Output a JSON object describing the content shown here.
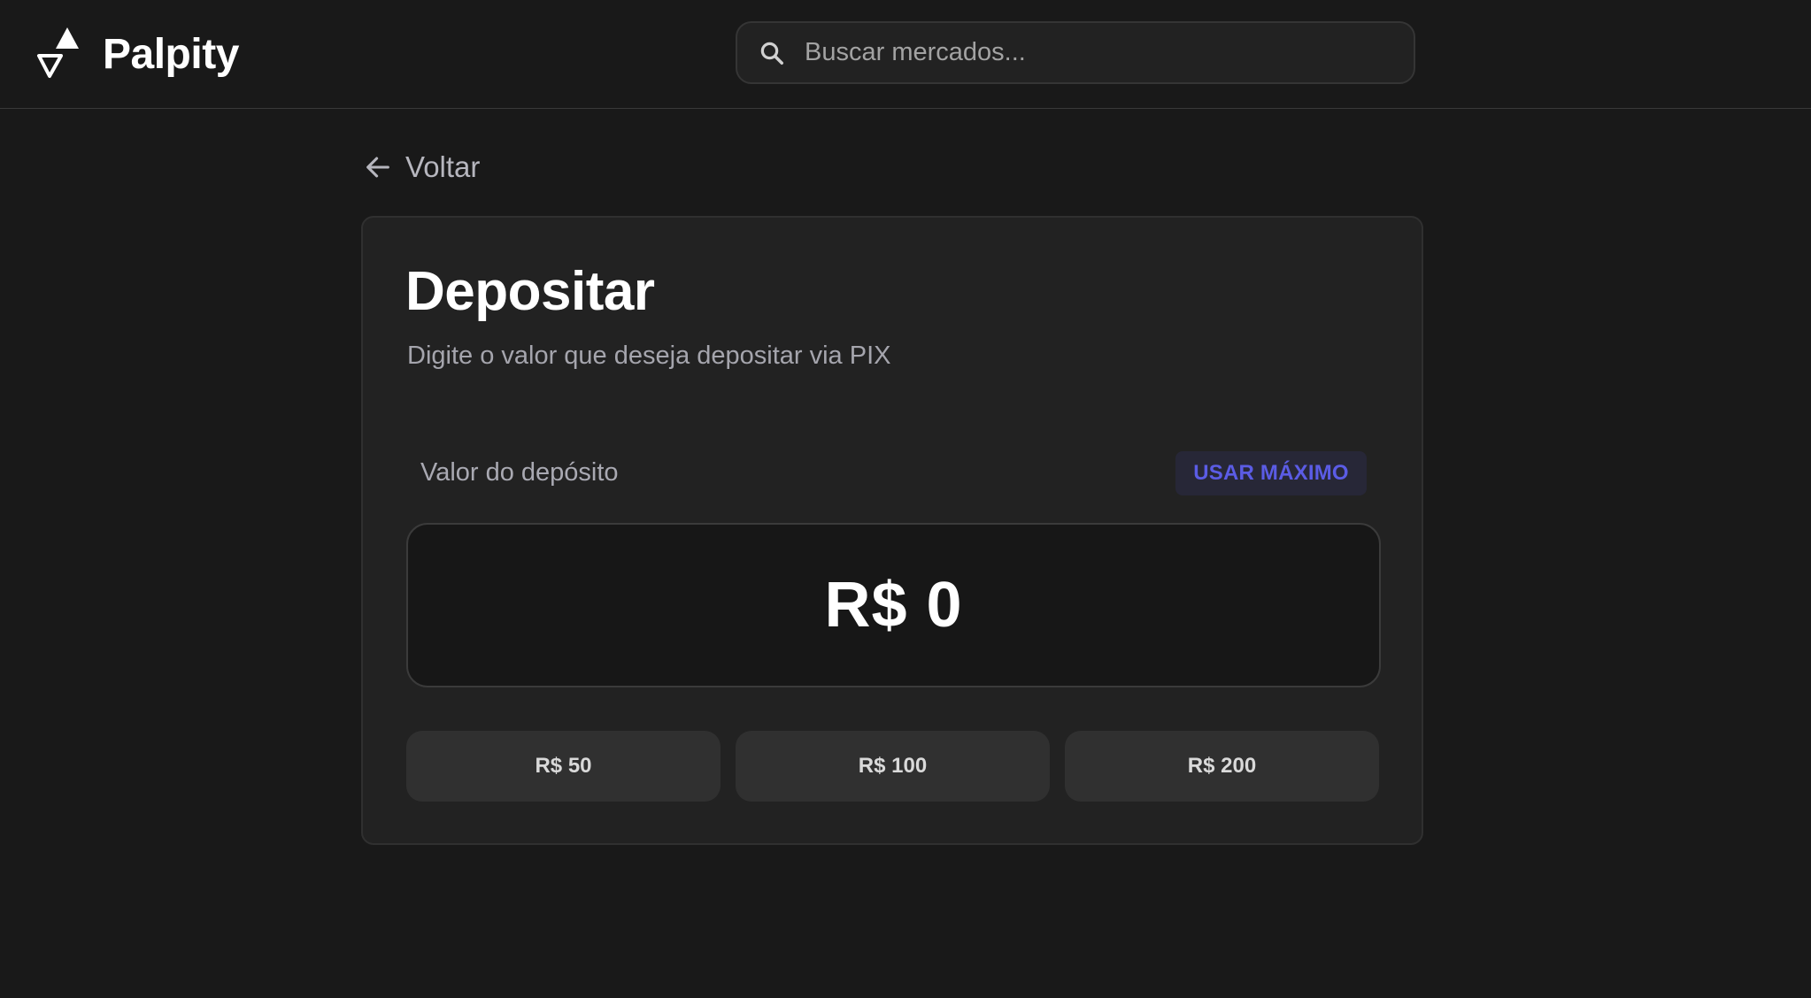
{
  "header": {
    "brand": "Palpity",
    "logo_icon": "up-down-triangles-logo",
    "search": {
      "icon": "search-icon",
      "placeholder": "Buscar mercados..."
    }
  },
  "nav": {
    "back_label": "Voltar",
    "back_icon": "arrow-left-icon"
  },
  "deposit": {
    "title": "Depositar",
    "subtitle": "Digite o valor que deseja depositar via PIX",
    "amount_label": "Valor do depósito",
    "max_button": "USAR MÁXIMO",
    "amount_value": "R$ 0",
    "quick_amounts": [
      "R$ 50",
      "R$ 100",
      "R$ 200"
    ]
  },
  "colors": {
    "background": "#191919",
    "card": "#222222",
    "accent": "#5b5ce5",
    "muted_text": "#a5a5ad"
  }
}
